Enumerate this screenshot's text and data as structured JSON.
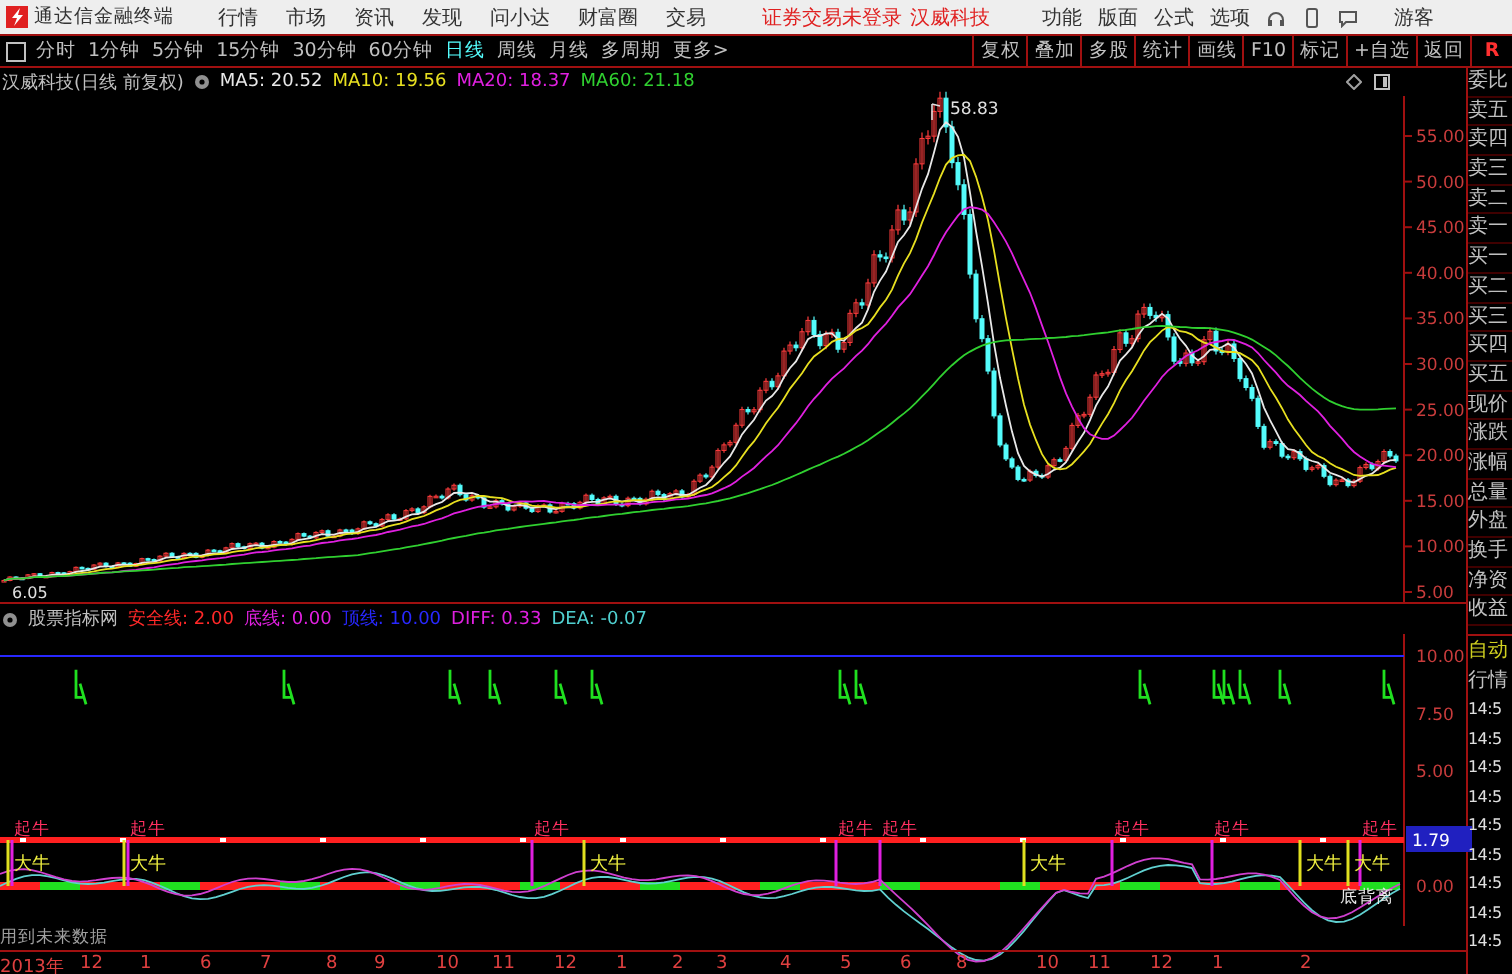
{
  "menu_bar": {
    "app_name": "通达信金融终端",
    "menus": [
      "行情",
      "市场",
      "资讯",
      "发现",
      "问小达",
      "财富圈",
      "交易"
    ],
    "login_status": "证券交易未登录",
    "stock_name": "汉威科技",
    "right_menus": [
      "功能",
      "版面",
      "公式",
      "选项"
    ],
    "user": "游客"
  },
  "toolbar": {
    "periods": [
      {
        "label": "分时",
        "selected": false
      },
      {
        "label": "1分钟",
        "selected": false
      },
      {
        "label": "5分钟",
        "selected": false
      },
      {
        "label": "15分钟",
        "selected": false
      },
      {
        "label": "30分钟",
        "selected": false
      },
      {
        "label": "60分钟",
        "selected": false
      },
      {
        "label": "日线",
        "selected": true
      },
      {
        "label": "周线",
        "selected": false
      },
      {
        "label": "月线",
        "selected": false
      },
      {
        "label": "多周期",
        "selected": false
      },
      {
        "label": "更多>",
        "selected": false
      }
    ],
    "actions": [
      "复权",
      "叠加",
      "多股",
      "统计",
      "画线",
      "F10",
      "标记",
      "+自选",
      "返回"
    ],
    "side_label": "R"
  },
  "price_pane": {
    "title": "汉威科技(日线 前复权)",
    "indicators": [
      {
        "label": "MA5: 20.52",
        "color": "#e8e8e8"
      },
      {
        "label": "MA10: 19.56",
        "color": "#e8e020"
      },
      {
        "label": "MA20: 18.37",
        "color": "#e020e0"
      },
      {
        "label": "MA60: 21.18",
        "color": "#30d030"
      }
    ],
    "axis_labels": [
      "55.00",
      "50.00",
      "45.00",
      "40.00",
      "35.00",
      "30.00",
      "25.00",
      "20.00",
      "15.00",
      "10.00",
      "5.00"
    ],
    "high_label": "58.83",
    "low_label": "6.05"
  },
  "indicator_pane": {
    "title": "股票指标网",
    "values": [
      {
        "label": "安全线: 2.00",
        "color": "#ff2828"
      },
      {
        "label": "底线: 0.00",
        "color": "#e020e0"
      },
      {
        "label": "顶线: 10.00",
        "color": "#2828ff"
      },
      {
        "label": "DIFF: 0.33",
        "color": "#e020e0"
      },
      {
        "label": "DEA: -0.07",
        "color": "#50d0d0"
      }
    ],
    "axis_labels": [
      "10.00",
      "7.50",
      "5.00",
      "0.00"
    ],
    "current_value": "1.79",
    "start_labels": [
      "起牛",
      "起牛",
      "起牛",
      "起牛",
      "起牛",
      "起牛",
      "起牛",
      "起牛"
    ],
    "bull_labels": [
      "大牛",
      "大牛",
      "大牛",
      "大牛",
      "大牛",
      "大牛"
    ],
    "divergence_label": "底背离"
  },
  "side_panel": {
    "quote_labels": [
      "委比",
      "卖五",
      "卖四",
      "卖三",
      "卖二",
      "卖一",
      "买一",
      "买二",
      "买三",
      "买四",
      "买五",
      "现价",
      "涨跌",
      "涨幅",
      "总量",
      "外盘",
      "换手",
      "净资",
      "收益"
    ],
    "mode": "自动",
    "section": "行情",
    "ticks": [
      "14:5",
      "14:5",
      "14:5",
      "14:5",
      "14:5",
      "14:5",
      "14:5",
      "14:5",
      "14:5"
    ]
  },
  "status_note": "用到未来数据",
  "time_axis": [
    "2013年",
    "12",
    "1",
    "6",
    "7",
    "8",
    "9",
    "10",
    "11",
    "12",
    "1",
    "2",
    "3",
    "4",
    "5",
    "6",
    "8",
    "10",
    "11",
    "12",
    "1",
    "2"
  ]
}
